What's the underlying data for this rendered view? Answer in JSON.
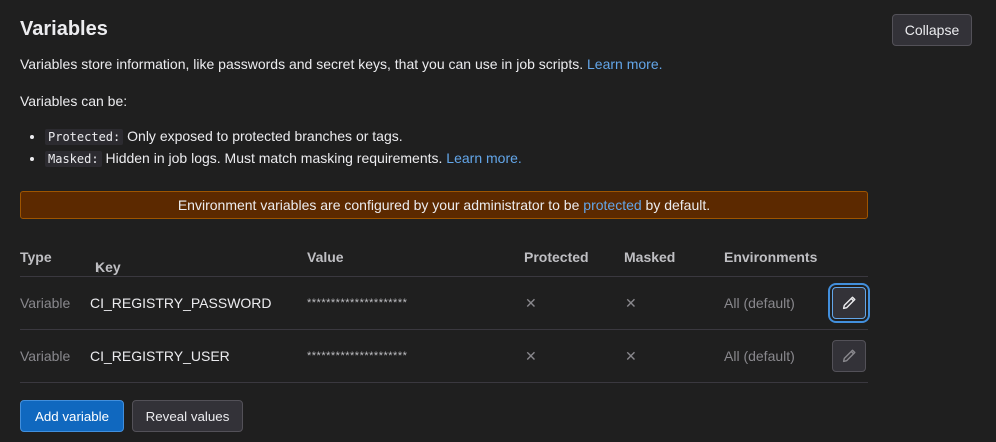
{
  "header": {
    "title": "Variables",
    "collapse_label": "Collapse"
  },
  "intro": {
    "text": "Variables store information, like passwords and secret keys, that you can use in job scripts.",
    "learn_more": "Learn more."
  },
  "can_be": "Variables can be:",
  "options": [
    {
      "code": "Protected:",
      "text": "Only exposed to protected branches or tags."
    },
    {
      "code": "Masked:",
      "text": "Hidden in job logs. Must match masking requirements.",
      "learn_more": "Learn more."
    }
  ],
  "alert": {
    "before": "Environment variables are configured by your administrator to be",
    "link": "protected",
    "after": "by default."
  },
  "table": {
    "columns": {
      "type": "Type",
      "key": "Key",
      "value": "Value",
      "protected": "Protected",
      "masked": "Masked",
      "environments": "Environments"
    },
    "sort_arrow": "↑",
    "rows": [
      {
        "type": "Variable",
        "key": "CI_REGISTRY_PASSWORD",
        "value": "*********************",
        "protected": "✕",
        "masked": "✕",
        "environment": "All (default)"
      },
      {
        "type": "Variable",
        "key": "CI_REGISTRY_USER",
        "value": "*********************",
        "protected": "✕",
        "masked": "✕",
        "environment": "All (default)"
      }
    ]
  },
  "actions": {
    "add_label": "Add variable",
    "reveal_label": "Reveal values"
  },
  "icons": {
    "edit": "pencil-icon",
    "close": "close-icon",
    "sort": "arrow-up-icon"
  },
  "colors": {
    "background": "#1f1f1f",
    "link": "#63a6e9",
    "alert_bg": "#5c2900",
    "primary": "#1068bf"
  }
}
